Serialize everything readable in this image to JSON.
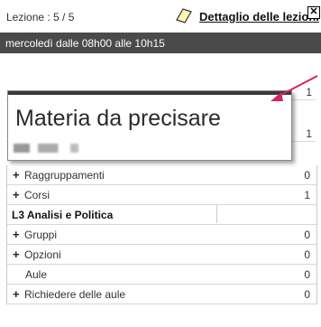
{
  "header": {
    "lesson_counter": "Lezione : 5 / 5",
    "detail_link": "Dettaglio delle lezioni",
    "close_label": "✕"
  },
  "timebar": {
    "text": "mercoledì dalle 08h00 alle 10h15"
  },
  "popup": {
    "title": "Materia da precisare"
  },
  "under_counts": [
    "1",
    "1"
  ],
  "rows": [
    {
      "plus": "+",
      "label": "Raggruppamenti",
      "count": "0"
    },
    {
      "plus": "+",
      "label": "Corsi",
      "count": "1"
    },
    {
      "section": "L3 Analisi e Politica"
    },
    {
      "plus": "+",
      "label": "Gruppi",
      "count": "0"
    },
    {
      "plus": "+",
      "label": "Opzioni",
      "count": "0"
    },
    {
      "plus": "",
      "label": "Aule",
      "count": "0"
    },
    {
      "plus": "+",
      "label": "Richiedere delle aule",
      "count": "0"
    }
  ],
  "colors": {
    "timebar_bg": "#4a4a4a",
    "arrow": "#d4245a"
  }
}
